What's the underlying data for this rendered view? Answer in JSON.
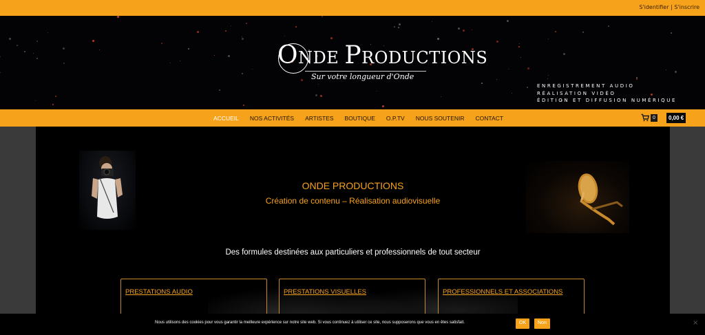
{
  "topbar": {
    "login": "S'identifier",
    "separator": "|",
    "register": "S'inscrire"
  },
  "brand": {
    "logo_initial": "O",
    "logo_rest": "NDE ",
    "logo_initial2": "P",
    "logo_rest2": "RODUCTIONS",
    "slogan": "Sur votre longueur d'Onde"
  },
  "services": [
    "ENREGISTREMENT AUDIO",
    "RÉALISATION VIDÉO",
    "ÉDITION ET DIFFUSION NUMÉRIQUE"
  ],
  "nav": {
    "items": [
      {
        "label": "Accueil",
        "active": true
      },
      {
        "label": "Nos activités"
      },
      {
        "label": "Artistes"
      },
      {
        "label": "Boutique"
      },
      {
        "label": "O.P.TV"
      },
      {
        "label": "Nous soutenir"
      },
      {
        "label": "Contact"
      }
    ],
    "cart_icon": "cart-icon",
    "cart_count": "0",
    "cart_total": "0,00 €"
  },
  "hero": {
    "title": "ONDE PRODUCTIONS",
    "subtitle": "Création de contenu – Réalisation audiovisuelle",
    "tagline": "Des formules destinées aux particuliers et professionnels de tout secteur"
  },
  "cards": [
    {
      "title": "PRESTATIONS AUDIO"
    },
    {
      "title": "PRESTATIONS VISUELLES"
    },
    {
      "title": "PROFESSIONNELS ET ASSOCIATIONS"
    }
  ],
  "cookie": {
    "text": "Nous utilisons des cookies pour vous garantir la meilleure expérience sur notre site web. Si vous continuez à utiliser ce site, nous supposerons que vous en êtes satisfait.",
    "ok": "OK",
    "no": "Non",
    "close": "×"
  },
  "colors": {
    "accent": "#f7a21b",
    "background": "#000000",
    "side": "#3a3a3a"
  }
}
